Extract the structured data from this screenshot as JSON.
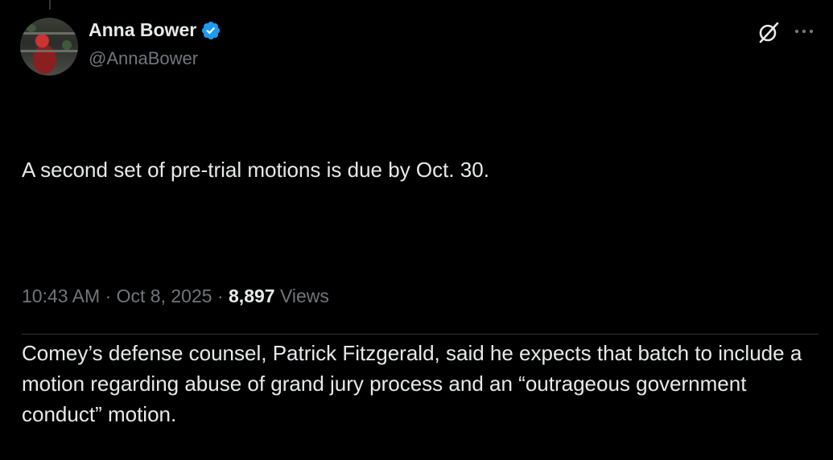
{
  "author": {
    "display_name": "Anna Bower",
    "handle": "@AnnaBower"
  },
  "tweet": {
    "paragraphs": [
      "A second set of pre-trial motions is due by Oct. 30.",
      "Comey’s defense counsel, Patrick Fitzgerald, said he expects that batch to include a motion regarding abuse of grand jury process and an “outrageous government conduct” motion."
    ],
    "time": "10:43 AM",
    "separator": " · ",
    "date": "Oct 8, 2025",
    "views_count": "8,897",
    "views_label": " Views"
  },
  "colors": {
    "background": "#000000",
    "text": "#e7e9ea",
    "muted": "#71767b",
    "verified": "#1d9bf0"
  },
  "icons": {
    "verified": "verified-badge-icon",
    "grok": "grok-icon",
    "more": "more-dots-icon"
  }
}
